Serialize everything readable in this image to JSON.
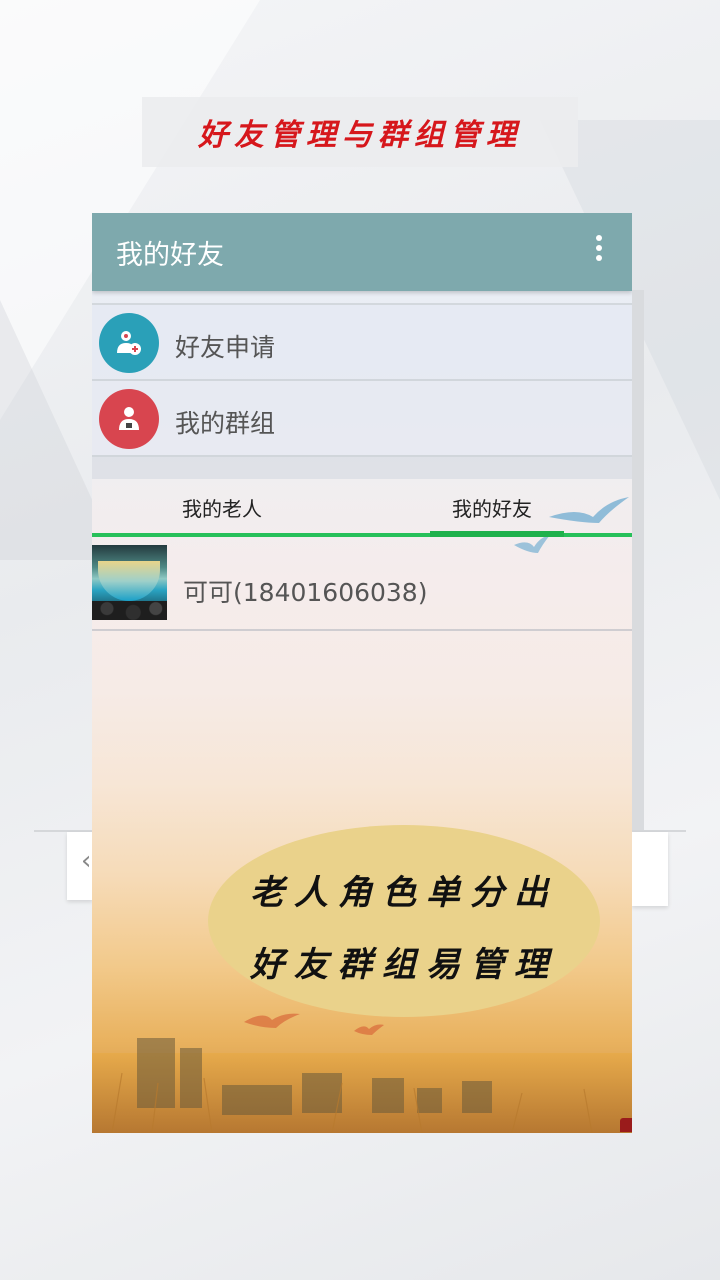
{
  "banner": {
    "title": "好友管理与群组管理"
  },
  "appbar": {
    "title": "我的好友",
    "more_icon": "more-vertical-icon"
  },
  "menu": {
    "items": [
      {
        "label": "好友申请",
        "icon": "add-friend-icon",
        "color": "#2aa0b8"
      },
      {
        "label": "我的群组",
        "icon": "group-icon",
        "color": "#d8454f"
      }
    ]
  },
  "tabs": [
    {
      "label": "我的老人",
      "selected": false
    },
    {
      "label": "我的好友",
      "selected": true
    }
  ],
  "accent": "#27c05a",
  "friends": [
    {
      "name": "可可(18401606038)"
    }
  ],
  "promo": {
    "line1": "老人角色单分出",
    "line2": "好友群组易管理"
  }
}
